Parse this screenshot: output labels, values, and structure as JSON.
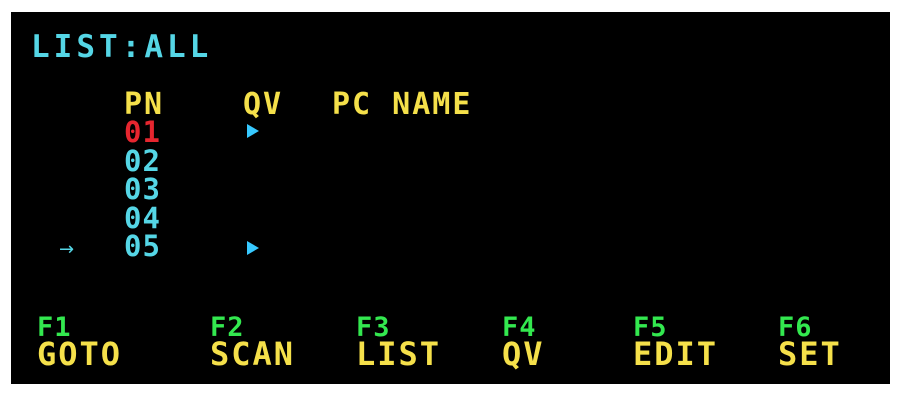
{
  "colors": {
    "cyan": "#55d6e6",
    "yellow": "#f5e04a",
    "red": "#e6262f",
    "green": "#33e84f",
    "marker_blue": "#37c9ff"
  },
  "title": "LIST:ALL",
  "columns": {
    "pn": "PN",
    "qv": "QV",
    "pc_name": "PC NAME"
  },
  "ports": [
    {
      "pn": "01",
      "qv": true,
      "active": true,
      "selected": false
    },
    {
      "pn": "02",
      "qv": false,
      "active": false,
      "selected": false
    },
    {
      "pn": "03",
      "qv": false,
      "active": false,
      "selected": false
    },
    {
      "pn": "04",
      "qv": false,
      "active": false,
      "selected": false
    },
    {
      "pn": "05",
      "qv": true,
      "active": false,
      "selected": true
    }
  ],
  "selection_arrow": "→",
  "function_keys": [
    {
      "key": "F1",
      "label": "GOTO"
    },
    {
      "key": "F2",
      "label": "SCAN"
    },
    {
      "key": "F3",
      "label": "LIST"
    },
    {
      "key": "F4",
      "label": "QV"
    },
    {
      "key": "F5",
      "label": "EDIT"
    },
    {
      "key": "F6",
      "label": "SET"
    }
  ],
  "icons": {
    "qv_marker": "play-triangle-icon",
    "selection": "right-arrow-icon"
  }
}
